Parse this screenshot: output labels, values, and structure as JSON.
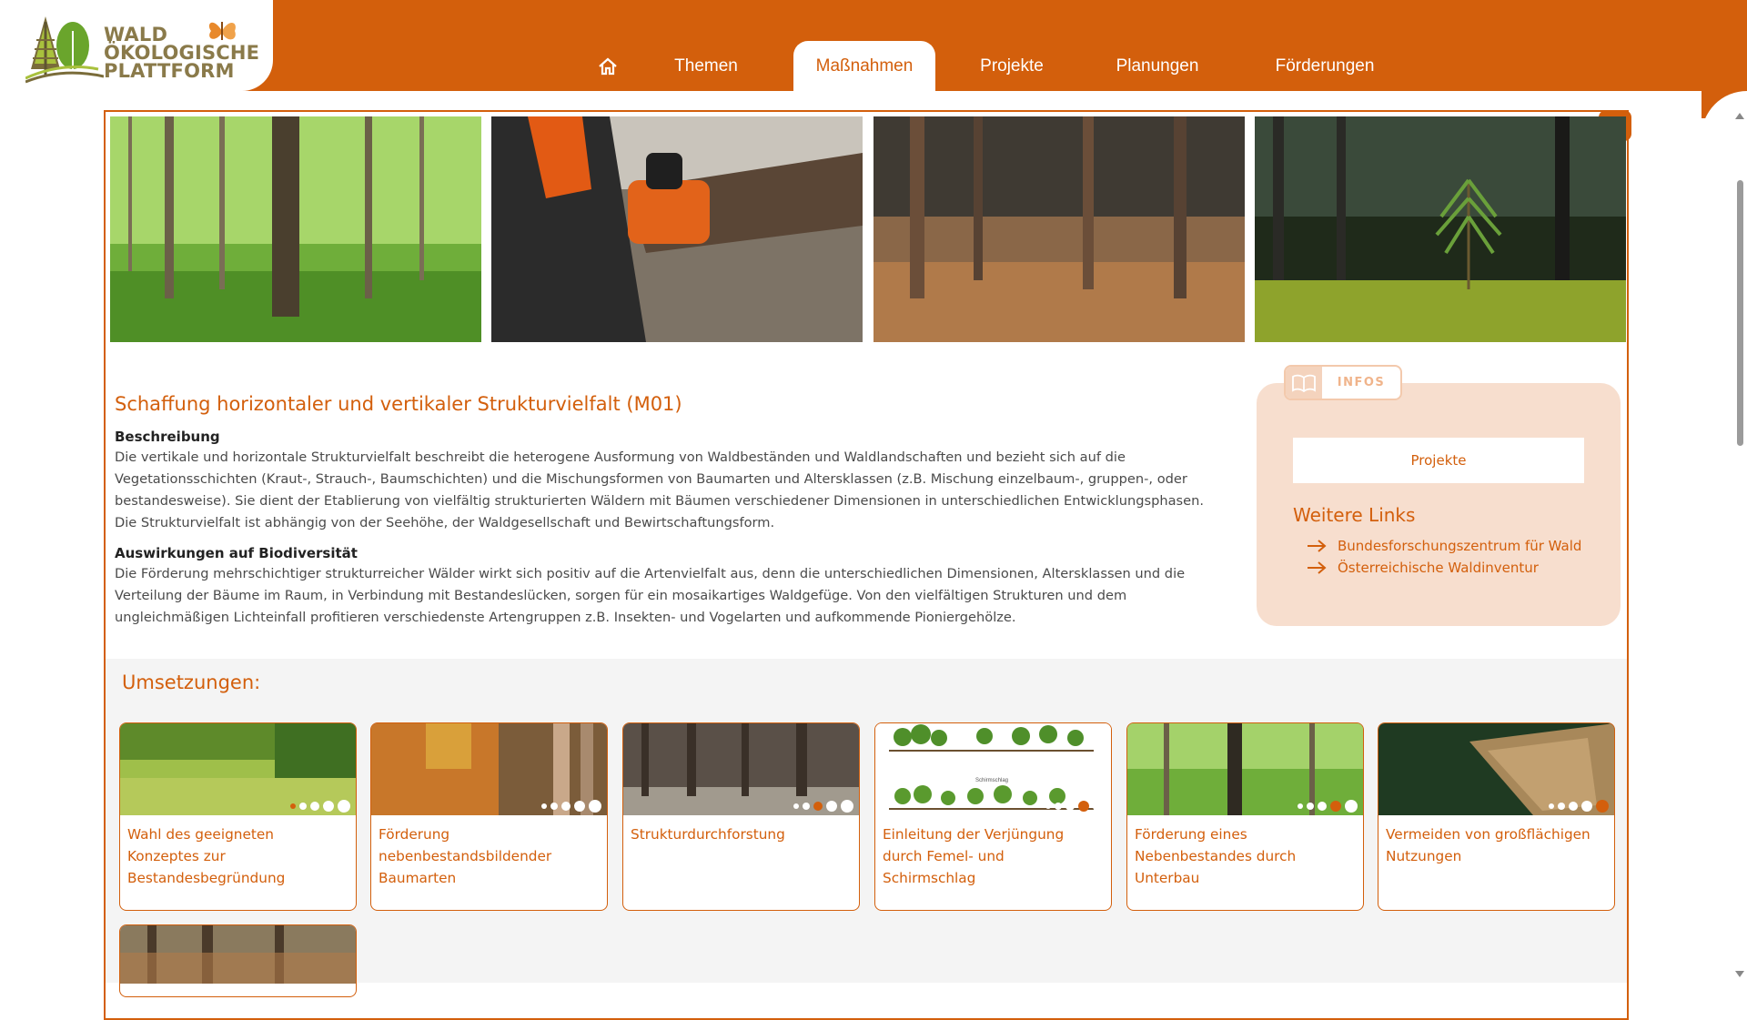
{
  "logo": {
    "line1": "WALD",
    "line2": "ÖKOLOGISCHE",
    "line3": "PLATTFORM"
  },
  "nav": {
    "home_icon": "home-icon",
    "items": [
      {
        "label": "Themen",
        "active": false
      },
      {
        "label": "Maßnahmen",
        "active": true
      },
      {
        "label": "Projekte",
        "active": false
      },
      {
        "label": "Planungen",
        "active": false
      },
      {
        "label": "Förderungen",
        "active": false
      }
    ]
  },
  "hero_images": [
    {
      "subject": "beech forest with green foliage"
    },
    {
      "subject": "worker cutting log with orange chainsaw"
    },
    {
      "subject": "spruce forest with brown undergrowth"
    },
    {
      "subject": "young pine seedling on moss"
    }
  ],
  "measure": {
    "title": "Schaffung horizontaler und vertikaler Strukturvielfalt (M01)",
    "description_heading": "Beschreibung",
    "description": "Die vertikale und horizontale Strukturvielfalt beschreibt die heterogene Ausformung von Waldbeständen und Waldlandschaften und bezieht sich auf die Vegetationsschichten (Kraut-, Strauch-, Baumschichten) und die Mischungsformen von Baumarten und Altersklassen (z.B. Mischung einzelbaum-, gruppen-, oder bestandesweise). Sie dient der Etablierung von vielfältig strukturierten Wäldern mit Bäumen verschiedener Dimensionen in unterschiedlichen Entwicklungsphasen. Die Strukturvielfalt ist abhängig von der Seehöhe, der Waldgesellschaft und Bewirtschaftungsform.",
    "biodiversity_heading": "Auswirkungen auf Biodiversität",
    "biodiversity": "Die Förderung mehrschichtiger strukturreicher Wälder wirkt sich positiv auf die Artenvielfalt aus, denn die unterschiedlichen Dimensionen, Altersklassen und die Verteilung der Bäume im Raum, in Verbindung mit Bestandeslücken, sorgen für ein mosaikartiges Waldgefüge. Von den vielfältigen Strukturen und dem ungleichmäßigen Lichteinfall profitieren verschiedenste Artengruppen z.B. Insekten- und Vogelarten und aufkommende Pioniergehölze."
  },
  "info": {
    "tab_label": "INFOS",
    "tab_icon": "book-icon",
    "projects_button": "Projekte",
    "links_title": "Weitere Links",
    "links": [
      "Bundesforschungszentrum für Wald",
      "Österreichische Waldinventur"
    ]
  },
  "implementations": {
    "title": "Umsetzungen:",
    "cards": [
      {
        "title": "Wahl des geeigneten Konzeptes zur Bestandesbegründung",
        "dots": 5,
        "active_dot": 0
      },
      {
        "title": "Förderung nebenbestandsbildender Baumarten",
        "dots": 5,
        "active_dot": -1
      },
      {
        "title": "Strukturdurchforstung",
        "dots": 5,
        "active_dot": 2
      },
      {
        "title": "Einleitung der Verjüngung durch Femel- und Schirmschlag",
        "dots": 5,
        "active_dot": 3,
        "diagram_label": "Schirmschlag"
      },
      {
        "title": "Förderung eines Nebenbestandes durch Unterbau",
        "dots": 5,
        "active_dot": 3
      },
      {
        "title": "Vermeiden von großflächigen Nutzungen",
        "dots": 5,
        "active_dot": 4
      }
    ]
  },
  "colors": {
    "accent": "#d35f0c",
    "info_bg": "#f7dece",
    "section_bg": "#f4f4f4"
  },
  "close_icon": "close-icon"
}
